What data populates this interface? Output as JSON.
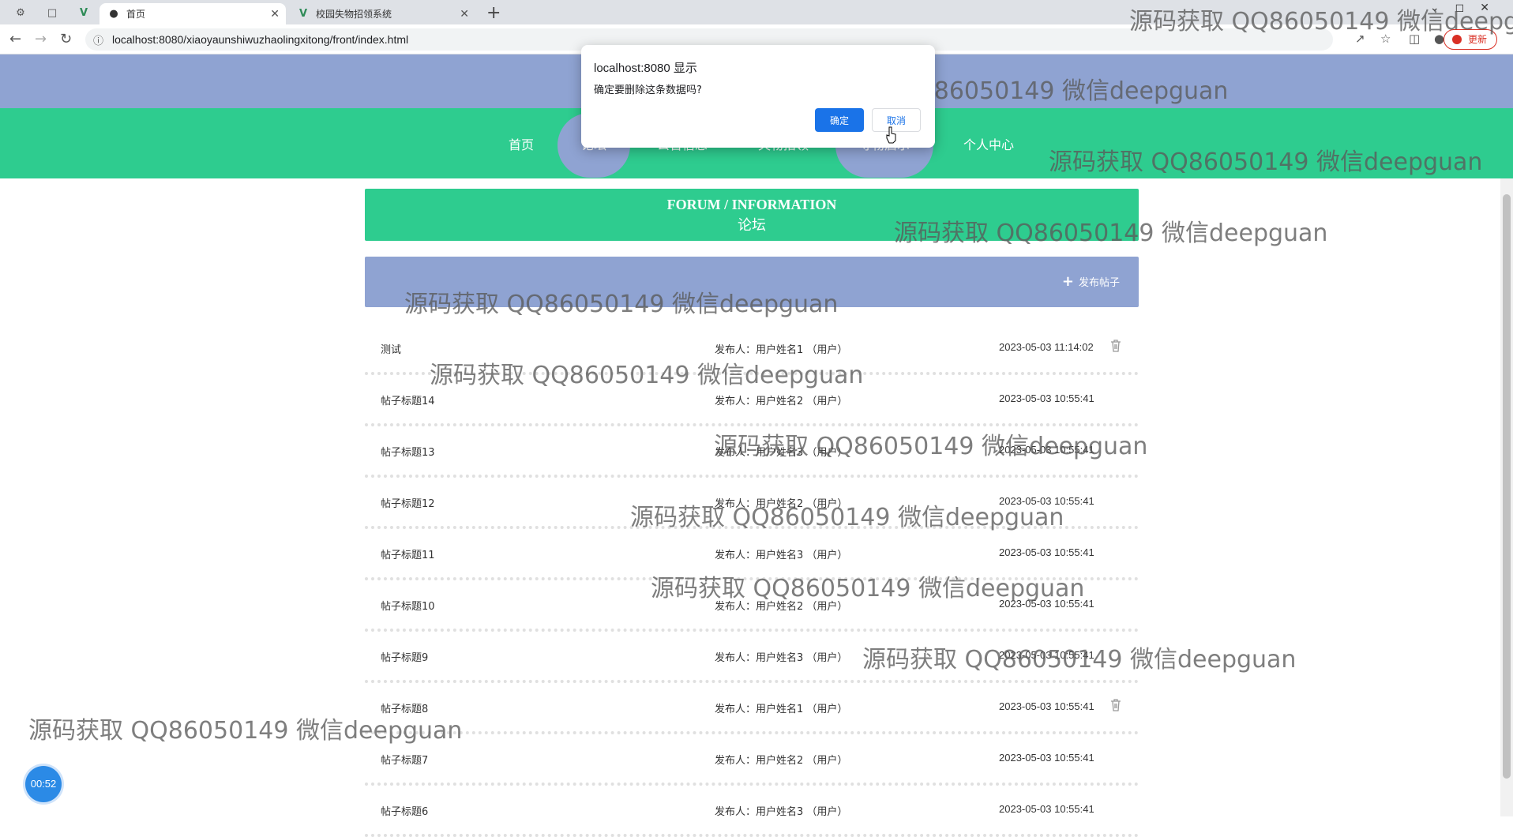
{
  "browser": {
    "tabs": [
      {
        "label": "首页",
        "active": true
      },
      {
        "label": "校园失物招领系统",
        "active": false
      }
    ],
    "url": "localhost:8080/xiaoyaunshiwuzhaolingxitong/front/index.html",
    "update_label": "更新"
  },
  "site": {
    "title": "校园失物招领系统",
    "nav": [
      "首页",
      "论坛",
      "公告信息",
      "失物招领",
      "寻物启示",
      "个人中心"
    ]
  },
  "section": {
    "title_en": "FORUM / INFORMATION",
    "title_zh": "论坛"
  },
  "toolbar": {
    "publish_label": "发布帖子"
  },
  "posts": [
    {
      "title": "测试",
      "author": "发布人：用户姓名1 （用户）",
      "time": "2023-05-03 11:14:02",
      "deletable": true
    },
    {
      "title": "帖子标题14",
      "author": "发布人：用户姓名2 （用户）",
      "time": "2023-05-03 10:55:41",
      "deletable": false
    },
    {
      "title": "帖子标题13",
      "author": "发布人：用户姓名3 （用户）",
      "time": "2023-05-03 10:55:41",
      "deletable": false
    },
    {
      "title": "帖子标题12",
      "author": "发布人：用户姓名2 （用户）",
      "time": "2023-05-03 10:55:41",
      "deletable": false
    },
    {
      "title": "帖子标题11",
      "author": "发布人：用户姓名3 （用户）",
      "time": "2023-05-03 10:55:41",
      "deletable": false
    },
    {
      "title": "帖子标题10",
      "author": "发布人：用户姓名2 （用户）",
      "time": "2023-05-03 10:55:41",
      "deletable": false
    },
    {
      "title": "帖子标题9",
      "author": "发布人：用户姓名3 （用户）",
      "time": "2023-05-03 10:55:41",
      "deletable": false
    },
    {
      "title": "帖子标题8",
      "author": "发布人：用户姓名1 （用户）",
      "time": "2023-05-03 10:55:41",
      "deletable": true
    },
    {
      "title": "帖子标题7",
      "author": "发布人：用户姓名2 （用户）",
      "time": "2023-05-03 10:55:41",
      "deletable": false
    },
    {
      "title": "帖子标题6",
      "author": "发布人：用户姓名3 （用户）",
      "time": "2023-05-03 10:55:41",
      "deletable": false
    }
  ],
  "dialog": {
    "title": "localhost:8080 显示",
    "message": "确定要删除这条数据吗?",
    "ok_label": "确定",
    "cancel_label": "取消"
  },
  "timer": "00:52",
  "watermark": "源码获取 QQ86050149 微信deepguan",
  "colors": {
    "primary_green": "#2ecc8f",
    "header_blue": "#8fa3d2",
    "dialog_button": "#1a73e8"
  }
}
